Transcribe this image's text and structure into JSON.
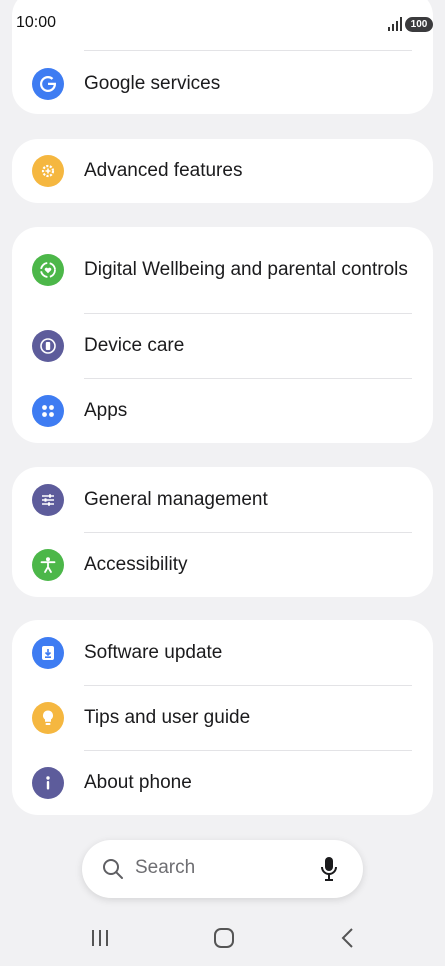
{
  "status_bar": {
    "time": "10:00",
    "battery": "100"
  },
  "cards": [
    {
      "rows": [
        {
          "label": "Google services",
          "icon": "google-icon",
          "color": "#3e7cf2"
        }
      ]
    },
    {
      "rows": [
        {
          "label": "Advanced features",
          "icon": "gear-plus-icon",
          "color": "#f5b740"
        }
      ]
    },
    {
      "rows": [
        {
          "label": "Digital Wellbeing and parental controls",
          "icon": "heart-circle-icon",
          "color": "#4cb749"
        },
        {
          "label": "Device care",
          "icon": "battery-care-icon",
          "color": "#5d5c9b"
        },
        {
          "label": "Apps",
          "icon": "apps-grid-icon",
          "color": "#3e7cf2"
        }
      ]
    },
    {
      "rows": [
        {
          "label": "General management",
          "icon": "sliders-icon",
          "color": "#5d5c9b"
        },
        {
          "label": "Accessibility",
          "icon": "accessibility-person-icon",
          "color": "#4cb749"
        }
      ]
    },
    {
      "rows": [
        {
          "label": "Software update",
          "icon": "download-icon",
          "color": "#3e7cf2"
        },
        {
          "label": "Tips and user guide",
          "icon": "lightbulb-icon",
          "color": "#f5b740"
        },
        {
          "label": "About phone",
          "icon": "info-icon",
          "color": "#5d5c9b"
        }
      ]
    }
  ],
  "search": {
    "placeholder": "Search"
  }
}
